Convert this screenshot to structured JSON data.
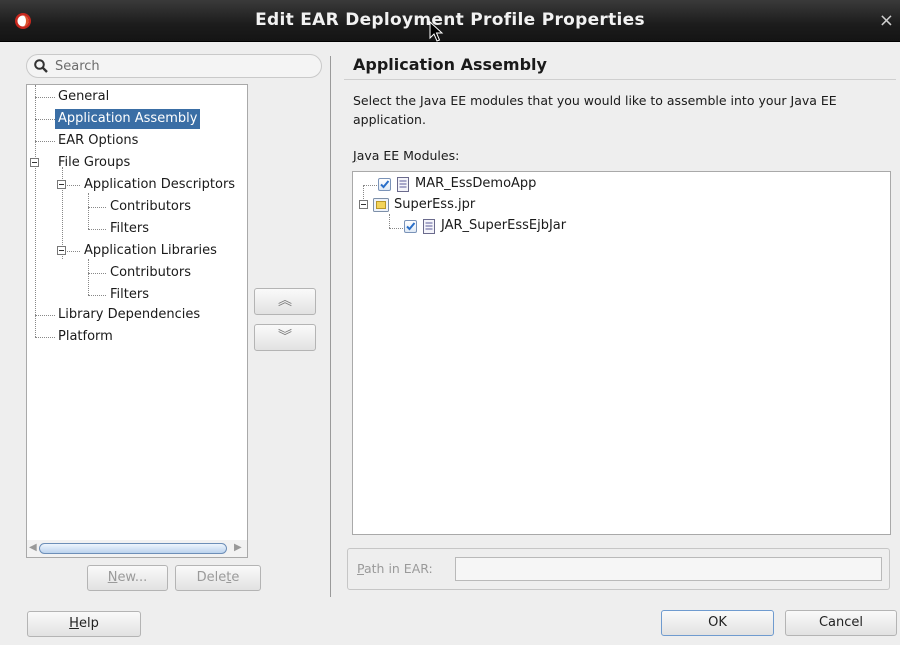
{
  "window": {
    "title": "Edit EAR Deployment Profile Properties",
    "close_glyph": "×"
  },
  "search": {
    "placeholder": "Search"
  },
  "nav_tree": {
    "general": "General",
    "application_assembly": "Application Assembly",
    "ear_options": "EAR Options",
    "file_groups": "File Groups",
    "application_descriptors": "Application Descriptors",
    "ad_contributors": "Contributors",
    "ad_filters": "Filters",
    "application_libraries": "Application Libraries",
    "al_contributors": "Contributors",
    "al_filters": "Filters",
    "library_dependencies": "Library Dependencies",
    "platform": "Platform",
    "selected": "Application Assembly"
  },
  "tree_buttons": {
    "new": {
      "mnemonic": "N",
      "rest": "ew..."
    },
    "delete": {
      "before": "Dele",
      "mnemonic": "t",
      "after": "e"
    }
  },
  "move_buttons": {
    "up_glyph": "︽",
    "down_glyph": "︾"
  },
  "panel": {
    "title": "Application Assembly",
    "description": "Select the Java EE modules that you would like to assemble into your Java EE application.",
    "modules_label": {
      "mnemonic": "J",
      "rest": "ava EE Modules:"
    }
  },
  "modules": [
    {
      "name": "MAR_EssDemoApp",
      "checked": true,
      "icon": "document-icon"
    },
    {
      "name": "SuperEss.jpr",
      "icon": "project-folder-icon",
      "expanded": true
    },
    {
      "name": "JAR_SuperEssEjbJar",
      "checked": true,
      "icon": "document-icon"
    }
  ],
  "path_in_ear": {
    "mnemonic": "P",
    "rest": "ath in EAR:",
    "value": ""
  },
  "footer": {
    "help": {
      "mnemonic": "H",
      "rest": "elp"
    },
    "ok": "OK",
    "cancel": "Cancel"
  },
  "colors": {
    "selection": "#3a6ea5",
    "titlebar": "#1c1c1c",
    "check": "#2a6fc9"
  }
}
